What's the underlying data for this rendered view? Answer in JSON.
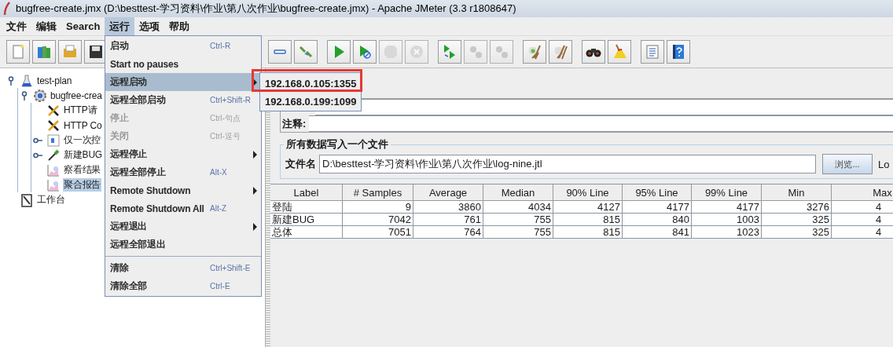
{
  "window": {
    "title": "bugfree-create.jmx (D:\\besttest-学习资料\\作业\\第八次作业\\bugfree-create.jmx) - Apache JMeter (3.3 r1808647)"
  },
  "menubar": [
    {
      "label": "文件",
      "selected": false
    },
    {
      "label": "编辑",
      "selected": false
    },
    {
      "label": "Search",
      "selected": false
    },
    {
      "label": "运行",
      "selected": true
    },
    {
      "label": "选项",
      "selected": false
    },
    {
      "label": "帮助",
      "selected": false
    }
  ],
  "toolbar": [
    [
      {
        "kind": "new",
        "disabled": false
      },
      {
        "kind": "templates",
        "disabled": false
      },
      {
        "kind": "open",
        "disabled": false
      },
      {
        "kind": "save",
        "disabled": false
      }
    ],
    [
      {
        "kind": "collapse",
        "disabled": false
      },
      {
        "kind": "toggle",
        "disabled": false
      }
    ],
    [
      {
        "kind": "start",
        "disabled": false
      },
      {
        "kind": "start-no-pauses",
        "disabled": false
      },
      {
        "kind": "stop",
        "disabled": true
      },
      {
        "kind": "shutdown",
        "disabled": true
      }
    ],
    [
      {
        "kind": "remote-start",
        "disabled": false
      },
      {
        "kind": "remote-stop",
        "disabled": true
      },
      {
        "kind": "remote-shutdown",
        "disabled": true
      }
    ],
    [
      {
        "kind": "clear",
        "disabled": false
      },
      {
        "kind": "clear-all",
        "disabled": false
      }
    ],
    [
      {
        "kind": "search",
        "disabled": false
      },
      {
        "kind": "reset-search",
        "disabled": false
      }
    ],
    [
      {
        "kind": "functions",
        "disabled": false
      },
      {
        "kind": "help",
        "disabled": false
      }
    ]
  ],
  "run_menu": [
    {
      "kind": "item",
      "label": "启动",
      "shortcut": "Ctrl-R",
      "disabled": false,
      "highlighted": false,
      "submenu": false
    },
    {
      "kind": "item",
      "label": "Start no pauses",
      "disabled": false,
      "highlighted": false,
      "submenu": false
    },
    {
      "kind": "item",
      "label": "远程启动",
      "disabled": false,
      "highlighted": true,
      "submenu": true
    },
    {
      "kind": "item",
      "label": "远程全部启动",
      "shortcut": "Ctrl+Shift-R",
      "disabled": false,
      "highlighted": false,
      "submenu": false
    },
    {
      "kind": "item",
      "label": "停止",
      "shortcut": "Ctrl-句点",
      "disabled": true,
      "highlighted": false,
      "submenu": false
    },
    {
      "kind": "item",
      "label": "关闭",
      "shortcut": "Ctrl-逗号",
      "disabled": true,
      "highlighted": false,
      "submenu": false
    },
    {
      "kind": "item",
      "label": "远程停止",
      "disabled": false,
      "highlighted": false,
      "submenu": true
    },
    {
      "kind": "item",
      "label": "远程全部停止",
      "shortcut": "Alt-X",
      "disabled": false,
      "highlighted": false,
      "submenu": false
    },
    {
      "kind": "item",
      "label": "Remote Shutdown",
      "disabled": false,
      "highlighted": false,
      "submenu": true
    },
    {
      "kind": "item",
      "label": "Remote Shutdown All",
      "shortcut": "Alt-Z",
      "disabled": false,
      "highlighted": false,
      "submenu": false
    },
    {
      "kind": "item",
      "label": "远程退出",
      "disabled": false,
      "highlighted": false,
      "submenu": true
    },
    {
      "kind": "item",
      "label": "远程全部退出",
      "disabled": false,
      "highlighted": false,
      "submenu": false
    },
    {
      "kind": "separator"
    },
    {
      "kind": "item",
      "label": "清除",
      "shortcut": "Ctrl+Shift-E",
      "disabled": false,
      "highlighted": false,
      "submenu": false
    },
    {
      "kind": "item",
      "label": "清除全部",
      "shortcut": "Ctrl-E",
      "disabled": false,
      "highlighted": false,
      "submenu": false
    }
  ],
  "remote_submenu": [
    {
      "label": "192.168.0.105:1355",
      "annotated": true
    },
    {
      "label": "192.168.0.199:1099",
      "annotated": false
    }
  ],
  "tree": [
    {
      "label": "test-plan",
      "kind": "plan",
      "expanded": true,
      "selected": false,
      "children": [
        {
          "label": "bugfree-crea",
          "kind": "thread-group",
          "expanded": true,
          "selected": false,
          "children": [
            {
              "label": "HTTP请",
              "kind": "tools",
              "selected": false
            },
            {
              "label": "HTTP Co",
              "kind": "tools",
              "selected": false
            },
            {
              "label": "仅一次控",
              "kind": "controller",
              "expanded": false,
              "selected": false
            },
            {
              "label": "新建BUG",
              "kind": "sampler",
              "expanded": false,
              "selected": false
            },
            {
              "label": "察看结果",
              "kind": "chart",
              "selected": false
            },
            {
              "label": "聚合报告",
              "kind": "chart",
              "selected": true
            }
          ]
        }
      ]
    },
    {
      "label": "工作台",
      "kind": "workbench",
      "selected": false
    }
  ],
  "panel": {
    "comment_label": "注释:",
    "file_group": {
      "title": "所有数据写入一个文件",
      "filename_label": "文件名",
      "filename": "D:\\besttest-学习资料\\作业\\第八次作业\\log-nine.jtl",
      "browse_button": "浏览...",
      "cut_label": "Lo"
    }
  },
  "table": {
    "columns": [
      "Label",
      "# Samples",
      "Average",
      "Median",
      "90% Line",
      "95% Line",
      "99% Line",
      "Min",
      "Max"
    ],
    "rows": [
      [
        "登陆",
        "9",
        "3860",
        "4034",
        "4127",
        "4177",
        "4177",
        "3276",
        "4"
      ],
      [
        "新建BUG",
        "7042",
        "761",
        "755",
        "815",
        "840",
        "1003",
        "325",
        "4"
      ],
      [
        "总体",
        "7051",
        "764",
        "755",
        "815",
        "841",
        "1023",
        "325",
        "4"
      ]
    ]
  }
}
